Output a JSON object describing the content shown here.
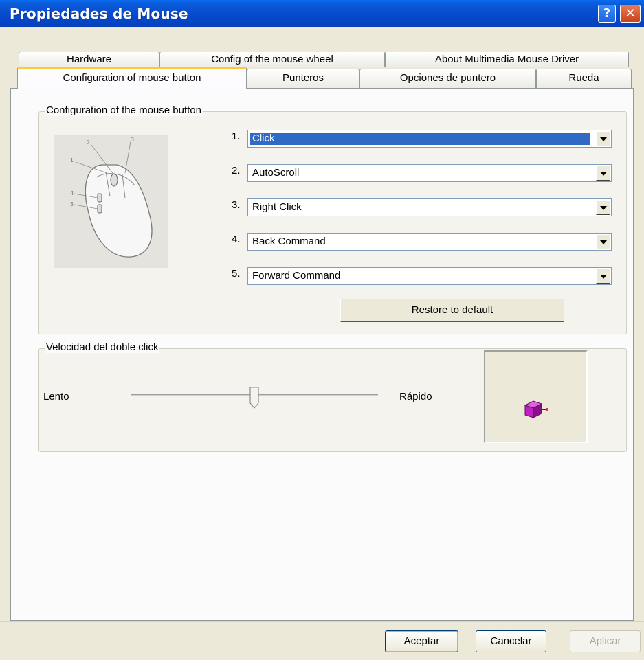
{
  "window": {
    "title": "Propiedades de Mouse",
    "help_glyph": "?",
    "close_glyph": "✕"
  },
  "tabs": {
    "row1": [
      {
        "label": "Hardware"
      },
      {
        "label": "Config of the mouse wheel"
      },
      {
        "label": "About Multimedia Mouse Driver"
      }
    ],
    "row2": [
      {
        "label": "Configuration of mouse button",
        "active": true
      },
      {
        "label": "Punteros"
      },
      {
        "label": "Opciones de puntero"
      },
      {
        "label": "Rueda"
      }
    ]
  },
  "button_config": {
    "group_label": "Configuration of the mouse button",
    "callouts": [
      "1",
      "2",
      "3",
      "4",
      "5"
    ],
    "rows": [
      {
        "number": "1.",
        "value": "Click",
        "selected": true
      },
      {
        "number": "2.",
        "value": "AutoScroll"
      },
      {
        "number": "3.",
        "value": "Right Click"
      },
      {
        "number": "4.",
        "value": "Back Command"
      },
      {
        "number": "5.",
        "value": "Forward Command"
      }
    ],
    "restore_label": "Restore to default"
  },
  "double_click": {
    "group_label": "Velocidad del doble click",
    "slow_label": "Lento",
    "fast_label": "Rápido",
    "speed_fraction": 0.5,
    "test_icon": "purple-box-icon"
  },
  "footer": {
    "ok_label": "Aceptar",
    "cancel_label": "Cancelar",
    "apply_label": "Aplicar"
  },
  "colors": {
    "titlebar": "#0a4fd0",
    "selection": "#316ac5",
    "tab_highlight": "#ffc83c",
    "dialog_bg": "#ece9d8",
    "test_box": "#c020c0"
  }
}
